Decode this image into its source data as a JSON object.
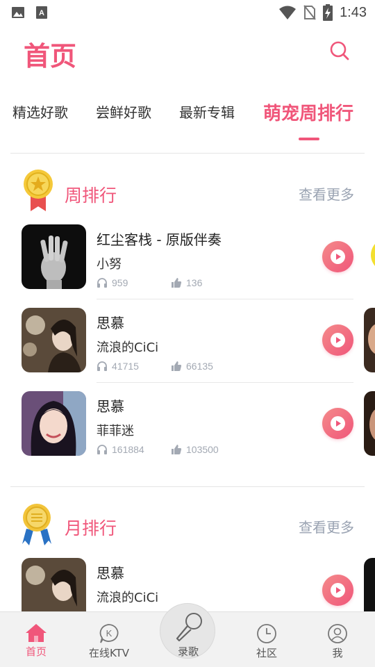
{
  "status_bar": {
    "time": "1:43",
    "left_icons": [
      "image-icon",
      "font-icon"
    ],
    "right_icons": [
      "wifi-icon",
      "no-sim-icon",
      "battery-charging-icon"
    ]
  },
  "header": {
    "title": "首页",
    "search_icon": "search-icon"
  },
  "tabs": [
    {
      "label": "精选好歌",
      "active": false
    },
    {
      "label": "尝鲜好歌",
      "active": false
    },
    {
      "label": "最新专辑",
      "active": false
    },
    {
      "label": "萌宠周排行",
      "active": true
    }
  ],
  "sections": [
    {
      "title": "周排行",
      "medal_icon": "gold-star-medal-icon",
      "more_label": "查看更多",
      "songs": [
        {
          "title": "红尘客栈 - 原版伴奏",
          "artist": "小努",
          "listens": "959",
          "likes": "136",
          "cover": "hand-photo"
        },
        {
          "title": "思慕",
          "artist": "流浪的CiCi",
          "listens": "41715",
          "likes": "66135",
          "cover": "woman-photo"
        },
        {
          "title": "思慕",
          "artist": "菲菲迷",
          "listens": "161884",
          "likes": "103500",
          "cover": "portrait-photo"
        }
      ]
    },
    {
      "title": "月排行",
      "medal_icon": "gold-ribbon-medal-icon",
      "more_label": "查看更多",
      "songs": [
        {
          "title": "思慕",
          "artist": "流浪的CiCi",
          "cover": "woman-photo"
        }
      ]
    }
  ],
  "bottom_nav": [
    {
      "label": "首页",
      "icon": "home-icon",
      "active": true
    },
    {
      "label": "在线KTV",
      "icon": "ktv-icon",
      "active": false
    },
    {
      "label": "录歌",
      "icon": "microphone-icon",
      "active": false
    },
    {
      "label": "社区",
      "icon": "clock-icon",
      "active": false
    },
    {
      "label": "我",
      "icon": "user-icon",
      "active": false
    }
  ],
  "colors": {
    "accent": "#f0567a",
    "muted_text": "#9aa3b2",
    "nav_background": "#f2f2f2"
  }
}
